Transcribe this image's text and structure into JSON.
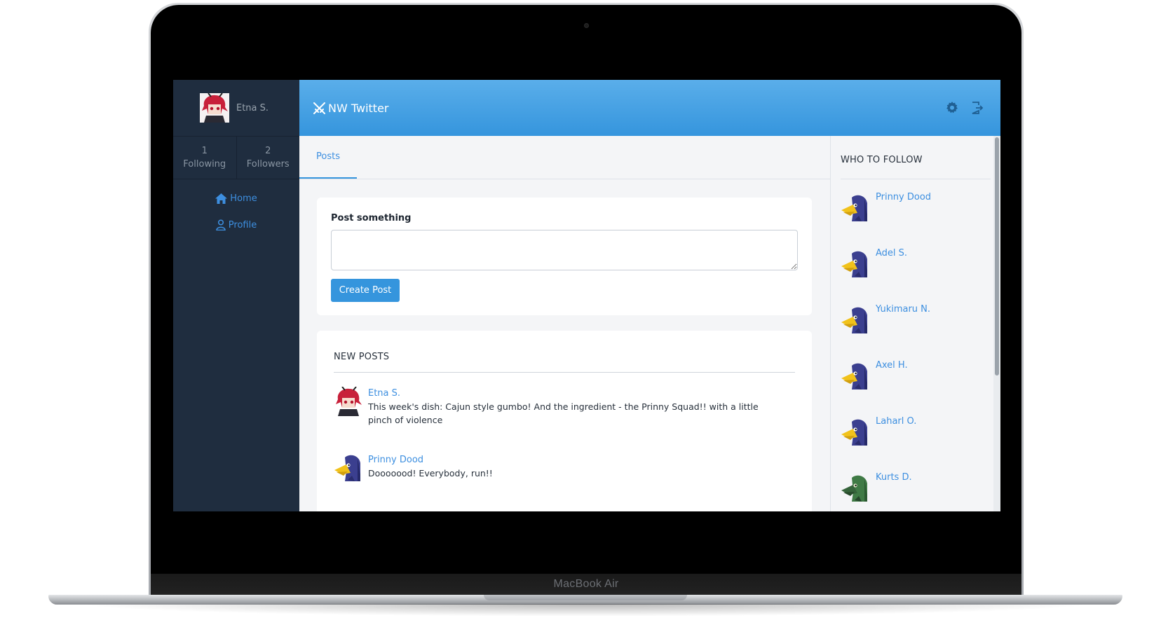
{
  "device": {
    "label": "MacBook Air"
  },
  "app": {
    "title": "NW Twitter"
  },
  "colors": {
    "accent": "#3595dd",
    "sidebar": "#1f2d3f",
    "link": "#3d8fe0"
  },
  "sidebar": {
    "user_name": "Etna S.",
    "stats": [
      {
        "count": "1",
        "label": "Following"
      },
      {
        "count": "2",
        "label": "Followers"
      }
    ],
    "nav": [
      {
        "label": "Home",
        "icon": "home-icon"
      },
      {
        "label": "Profile",
        "icon": "user-icon"
      }
    ]
  },
  "header": {
    "icons": [
      "gear-icon",
      "logout-icon"
    ]
  },
  "tabs": [
    {
      "label": "Posts",
      "active": true
    }
  ],
  "compose": {
    "label": "Post something",
    "placeholder": "",
    "value": "",
    "button": "Create Post"
  },
  "feed": {
    "title": "NEW POSTS",
    "posts": [
      {
        "author": "Etna S.",
        "text": "This week's dish: Cajun style gumbo! And the ingredient - the Prinny Squad!! with a little pinch of violence",
        "avatar": "etna-avatar"
      },
      {
        "author": "Prinny Dood",
        "text": "Dooooood! Everybody, run!!",
        "avatar": "prinny-avatar"
      }
    ]
  },
  "who_to_follow": {
    "title": "WHO TO FOLLOW",
    "users": [
      {
        "name": "Prinny Dood",
        "avatar": "prinny-avatar"
      },
      {
        "name": "Adel S.",
        "avatar": "prinny-avatar"
      },
      {
        "name": "Yukimaru N.",
        "avatar": "prinny-avatar"
      },
      {
        "name": "Axel H.",
        "avatar": "prinny-avatar"
      },
      {
        "name": "Laharl O.",
        "avatar": "prinny-avatar"
      },
      {
        "name": "Kurts D.",
        "avatar": "green-prinny-avatar"
      }
    ]
  }
}
